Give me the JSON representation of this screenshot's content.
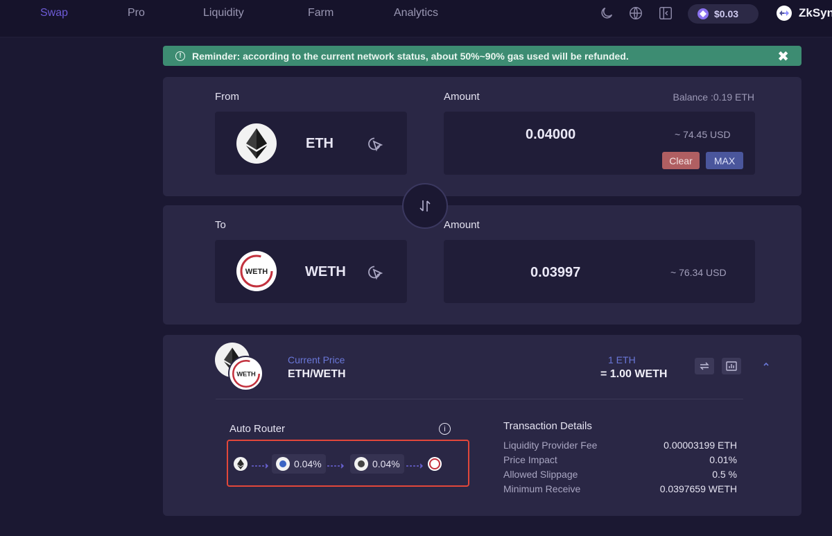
{
  "nav": {
    "items": [
      "Swap",
      "Pro",
      "Liquidity",
      "Farm",
      "Analytics"
    ],
    "active": "Swap",
    "price": "$0.03",
    "network": "ZkSyn"
  },
  "reminder": {
    "text": "Reminder: according to the current network status, about 50%~90% gas used will be refunded.",
    "close": "✖"
  },
  "from": {
    "label": "From",
    "token": "ETH",
    "amount_label": "Amount",
    "balance": "Balance :0.19 ETH",
    "amount": "0.04000",
    "usd": "~ 74.45 USD",
    "clear": "Clear",
    "max": "MAX"
  },
  "to": {
    "label": "To",
    "token": "WETH",
    "amount_label": "Amount",
    "amount": "0.03997",
    "usd": "~ 76.34 USD"
  },
  "price": {
    "label": "Current Price",
    "pair": "ETH/WETH",
    "rate_top": "1 ETH",
    "rate_bottom": "= 1.00 WETH"
  },
  "router": {
    "title": "Auto Router",
    "hops": [
      "0.04%",
      "0.04%"
    ]
  },
  "details": {
    "title": "Transaction Details",
    "rows": [
      {
        "label": "Liquidity Provider Fee",
        "value": "0.00003199 ETH"
      },
      {
        "label": "Price Impact",
        "value": "0.01%"
      },
      {
        "label": "Allowed Slippage",
        "value": "0.5 %"
      },
      {
        "label": "Minimum Receive",
        "value": "0.0397659 WETH"
      }
    ]
  },
  "colors": {
    "accent": "#6d5bd7",
    "reminder_bg": "#3d8c72",
    "clear_btn": "#b05f62",
    "max_btn": "#4a569c",
    "highlight_border": "#e2473a"
  },
  "token_logo_text": {
    "weth": "WETH"
  }
}
